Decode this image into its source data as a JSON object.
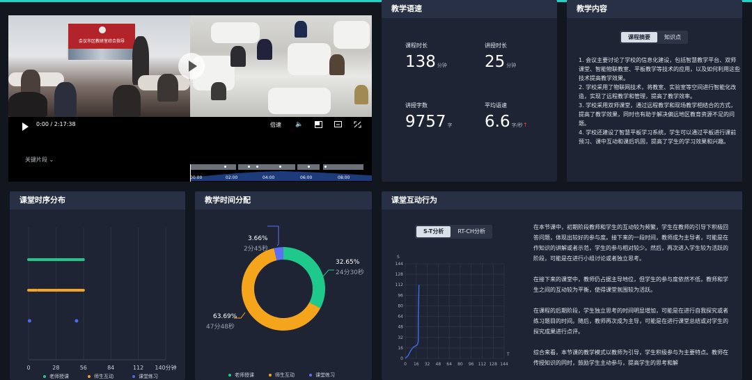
{
  "video": {
    "screen_text": "会议市区教研室综合指导",
    "time": "0:00 / 2:17:38",
    "speed_label": "倍速",
    "key_segments_label": "关键片段",
    "timeline_ticks": [
      "00:00",
      "02:00",
      "04:00",
      "06:00",
      "08:00"
    ]
  },
  "speech": {
    "title": "教学语速",
    "course_duration_label": "课程时长",
    "course_duration_value": "138",
    "course_duration_unit": "分钟",
    "lecture_duration_label": "讲授时长",
    "lecture_duration_value": "25",
    "lecture_duration_unit": "分钟",
    "word_count_label": "讲授字数",
    "word_count_value": "9757",
    "word_count_unit": "字",
    "avg_speed_label": "平均语速",
    "avg_speed_value": "6.6",
    "avg_speed_unit": "字/秒",
    "avg_speed_trend": "↑"
  },
  "content": {
    "title": "教学内容",
    "tabs": [
      "课程摘要",
      "知识点"
    ],
    "summary": [
      "1. 会议主要讨论了学校的信息化建设，包括智慧教学平台、双师课堂、智能物联教室、平板教学等技术的应用，以及如何利用这些技术提高教学效果。",
      "2. 学校采用了物联网技术，将教室、实验室等空间进行智能化改造，实现了远程教学和管理，提高了教学效率。",
      "3. 学校采用双师课堂，通过远程教学和现场教学相结合的方式，提高了教学效果，同时也有助于解决偏远地区教育资源不足的问题。",
      "4. 学校还建设了智慧平板学习系统，学生可以通过平板进行课前预习、课中互动和课后巩固，提高了学生的学习效果和兴趣。"
    ]
  },
  "timeline": {
    "title": "课堂时序分布",
    "x_ticks": [
      "0",
      "28",
      "56",
      "84",
      "112",
      "140分钟"
    ],
    "legend": [
      "老师授课",
      "师生互动",
      "课堂练习"
    ]
  },
  "distribution": {
    "title": "教学时间分配",
    "labels": [
      {
        "pct": "3.66%",
        "time": "2分45秒"
      },
      {
        "pct": "32.65%",
        "time": "24分30秒"
      },
      {
        "pct": "63.69%",
        "time": "47分48秒"
      }
    ],
    "legend": [
      "老师授课",
      "师生互动",
      "课堂练习"
    ]
  },
  "interaction": {
    "title": "课堂互动行为",
    "tabs": [
      "S-T分析",
      "RT-CH分析"
    ],
    "y_axis_label": "S",
    "x_axis_label": "T",
    "ticks": [
      "0",
      "16",
      "32",
      "48",
      "64",
      "80",
      "96",
      "112",
      "128",
      "144"
    ],
    "paragraphs": [
      "在本节课中，初期阶段教师和学生的互动较为频繁，学生在教师的引导下积极回答问题，体现出较好的参与度。接下来的一段时间，教师成为主导者，可能是在作知识的讲解或者示范，学生的参与相对较少。然后，再次进入学生较为活跃的阶段，可能是在进行小组讨论或者独立思考。",
      "在接下来的课堂中，教师仍占据主导地位，但学生的参与度依然不低，教师和学生之间的互动较为平衡，使得课堂氛围较为活跃。",
      "在课程的后期阶段，学生独立思考的时间明显增加，可能是在进行自我探究或者练习题目的时间。随后，教师再次成为主导，可能是在进行课堂总结或对学生的探究成果进行点评。",
      "综合来看，本节课的教学模式以教师为引导，学生积极参与为主要特点。教师在传授知识的同时，鼓励学生主动参与，提高学生的思考和解"
    ]
  },
  "chart_data": [
    {
      "type": "scatter",
      "title": "课堂时序分布",
      "xlim": [
        0,
        140
      ],
      "x_ticks": [
        0,
        28,
        56,
        84,
        112,
        140
      ],
      "series": [
        {
          "name": "老师授课",
          "color": "#1ec98b",
          "segments": [
            [
              0,
              56
            ]
          ]
        },
        {
          "name": "师生互动",
          "color": "#f5a51c",
          "segments": [
            [
              0,
              8
            ],
            [
              10,
              56
            ]
          ]
        },
        {
          "name": "课堂练习",
          "color": "#4a6cf0",
          "points": [
            1,
            49
          ]
        }
      ]
    },
    {
      "type": "pie",
      "title": "教学时间分配",
      "series": [
        {
          "name": "老师授课",
          "value": 32.65,
          "time": "24分30秒",
          "color": "#1ec98b"
        },
        {
          "name": "师生互动",
          "value": 63.69,
          "time": "47分48秒",
          "color": "#f5a51c"
        },
        {
          "name": "课堂练习",
          "value": 3.66,
          "time": "2分45秒",
          "color": "#5f6ff5"
        }
      ]
    },
    {
      "type": "line",
      "title": "S-T分析",
      "xlabel": "T",
      "ylabel": "S",
      "xlim": [
        0,
        144
      ],
      "ylim": [
        0,
        144
      ],
      "ticks": [
        0,
        16,
        32,
        48,
        64,
        80,
        96,
        112,
        128,
        144
      ],
      "x": [
        0,
        2,
        4,
        5,
        6,
        7,
        8,
        9,
        10,
        11,
        12,
        13,
        14,
        15,
        16,
        17,
        18,
        19,
        19,
        20
      ],
      "y": [
        0,
        2,
        4,
        6,
        8,
        10,
        12,
        13,
        15,
        16,
        17,
        18,
        18,
        19,
        20,
        20,
        22,
        26,
        60,
        112
      ]
    }
  ]
}
